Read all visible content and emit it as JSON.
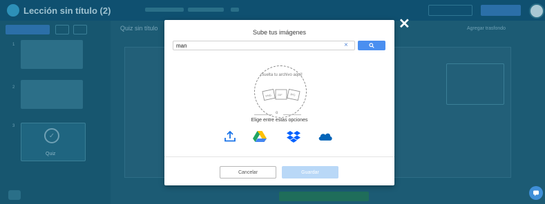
{
  "app": {
    "doc_title": "Lección sin título (2)",
    "topbar_items": [
      "",
      "",
      ""
    ],
    "preview_label": "",
    "save_label": ""
  },
  "sidebar": {
    "slides": [
      {
        "num": "1",
        "label": ""
      },
      {
        "num": "2",
        "label": ""
      },
      {
        "num": "3",
        "label": ""
      }
    ],
    "quiz_label": "Quiz"
  },
  "main": {
    "title": "Quiz sin título",
    "add_background": "Agregar trasfondo"
  },
  "modal": {
    "title": "Sube tus imágenes",
    "search": {
      "value": "man",
      "placeholder": ""
    },
    "drop_text": "¡Suelta tu archivo aquí!",
    "or_text": "o",
    "options_text": "Elige entre estas opciones",
    "sources": [
      {
        "icon": "upload-icon",
        "color": "#1a73e8"
      },
      {
        "icon": "google-drive-icon",
        "color": "#1fa463"
      },
      {
        "icon": "dropbox-icon",
        "color": "#0061fe"
      },
      {
        "icon": "onedrive-icon",
        "color": "#0364b8"
      }
    ],
    "cancel_label": "Cancelar",
    "save_label": "Guardar"
  },
  "colors": {
    "primary": "#4a8ff0",
    "overlay": "#1f5f78",
    "save_disabled": "#b9d8f7"
  }
}
